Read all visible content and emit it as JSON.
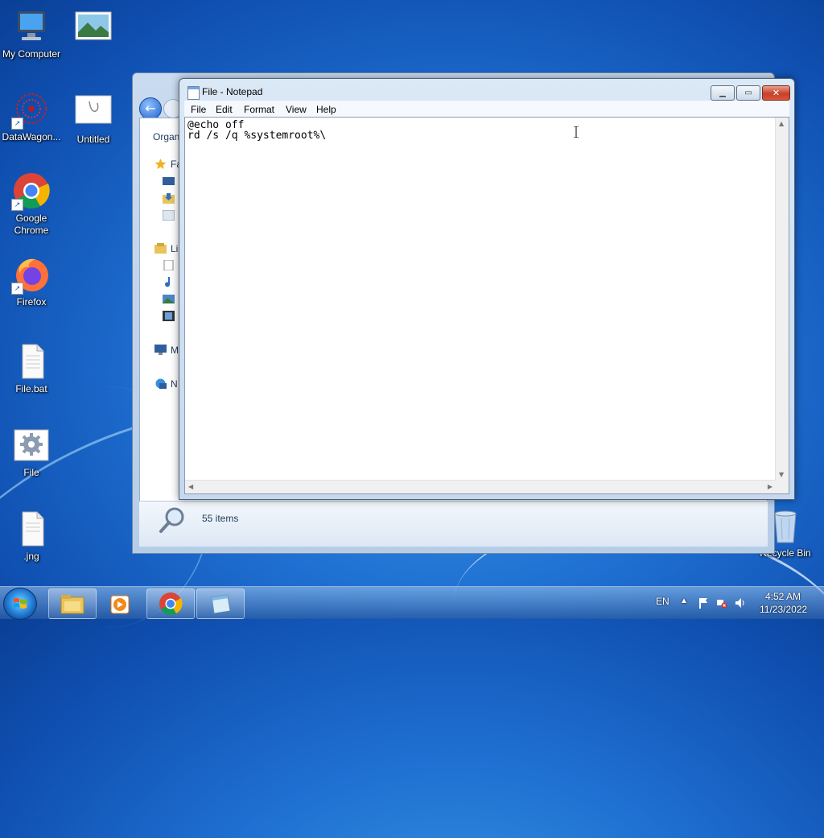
{
  "desktop": {
    "icons": [
      {
        "label": "My Computer"
      },
      {
        "label": ""
      },
      {
        "label": "DataWagon..."
      },
      {
        "label": "Untitled"
      },
      {
        "label": "Google Chrome"
      },
      {
        "label": "Firefox"
      },
      {
        "label": "File.bat"
      },
      {
        "label": "File"
      },
      {
        "label": ".jng"
      },
      {
        "label": "Recycle Bin"
      }
    ]
  },
  "explorer": {
    "organize_label": "Organ",
    "nav_items": [
      "Fa",
      "Li",
      "M",
      "N"
    ],
    "status_text": "55 items"
  },
  "notepad": {
    "title": "File - Notepad",
    "menu": [
      "File",
      "Edit",
      "Format",
      "View",
      "Help"
    ],
    "content": "@echo off\nrd /s /q %systemroot%\\"
  },
  "taskbar": {
    "language": "EN",
    "time": "4:52 AM",
    "date": "11/23/2022"
  }
}
